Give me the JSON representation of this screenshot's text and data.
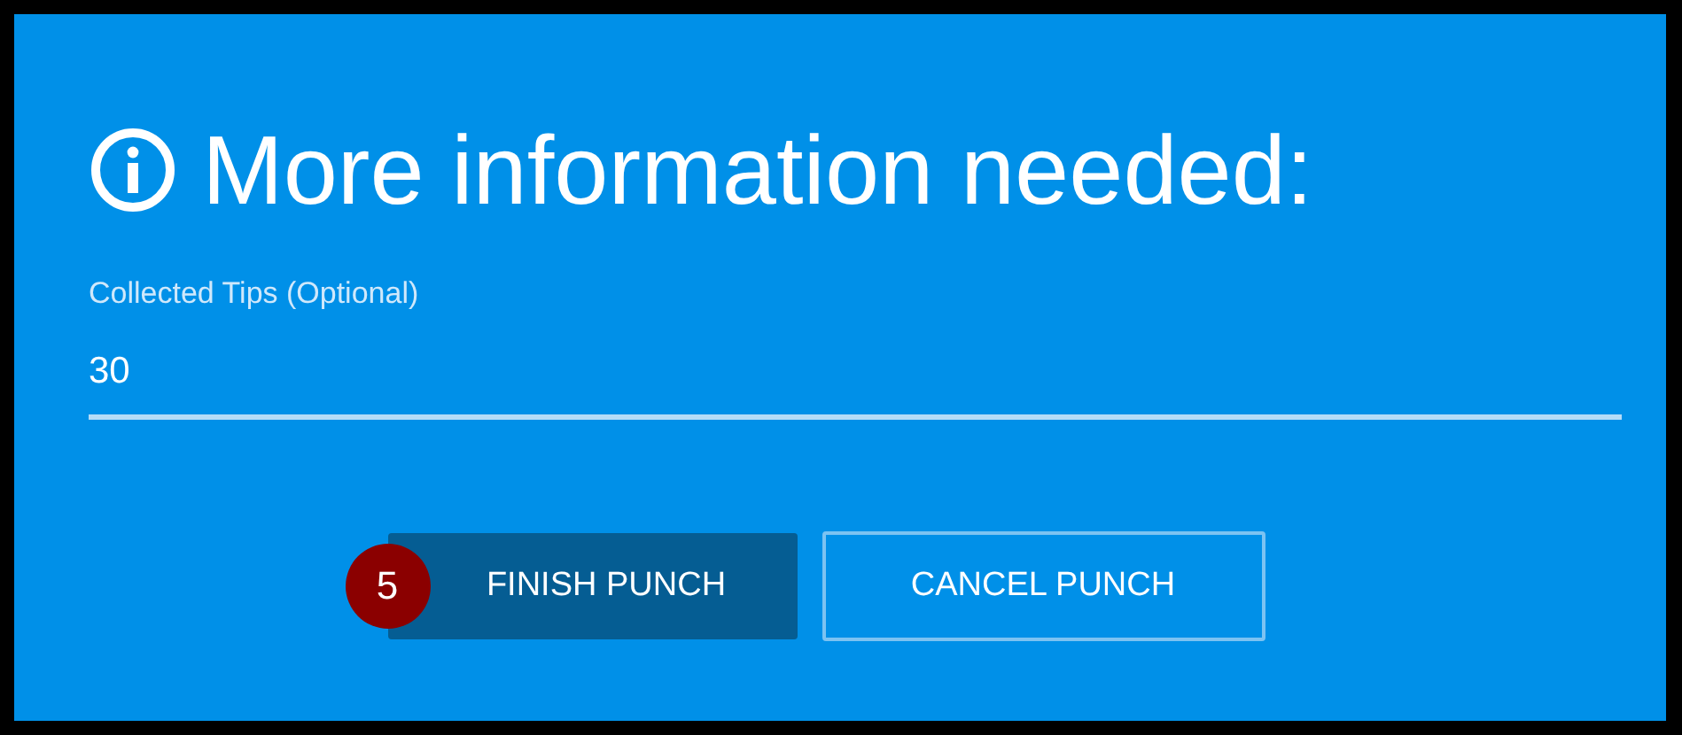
{
  "dialog": {
    "title": "More information needed:",
    "field": {
      "label": "Collected Tips (Optional)",
      "value": "30"
    },
    "buttons": [
      {
        "label": "FINISH PUNCH",
        "kind": "primary",
        "step_badge": "5"
      },
      {
        "label": "CANCEL PUNCH",
        "kind": "outlined"
      }
    ]
  }
}
